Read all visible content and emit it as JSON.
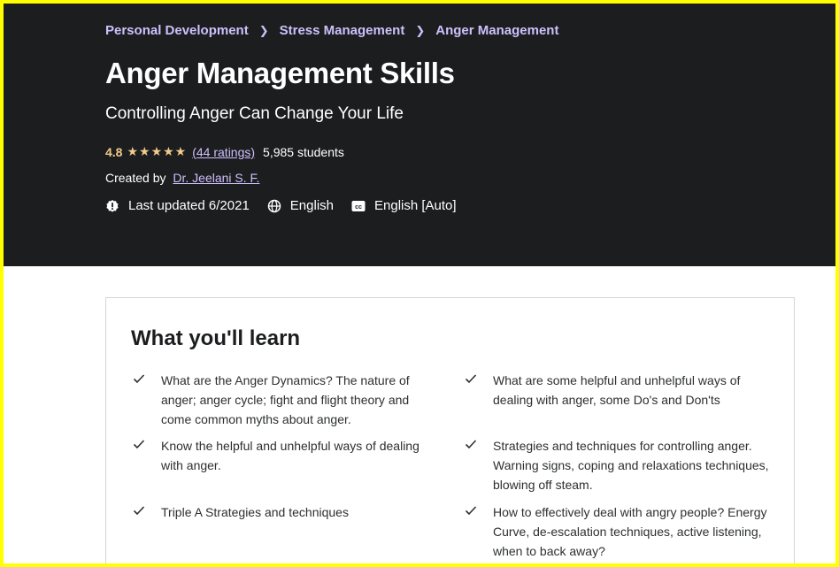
{
  "breadcrumb": [
    "Personal Development",
    "Stress Management",
    "Anger Management"
  ],
  "course": {
    "title": "Anger Management Skills",
    "subtitle": "Controlling Anger Can Change Your Life",
    "rating": "4.8",
    "stars": "★★★★★",
    "ratings_count": "(44 ratings)",
    "students": "5,985 students",
    "created_by_label": "Created by",
    "instructor": "Dr. Jeelani S. F.",
    "last_updated": "Last updated 6/2021",
    "language": "English",
    "captions": "English [Auto]"
  },
  "learn": {
    "heading": "What you'll learn",
    "left": [
      "What are the Anger Dynamics? The nature of anger; anger cycle; fight and flight theory and come common myths about anger.",
      "Know the helpful and unhelpful ways of dealing with anger.",
      "Triple A Strategies and techniques"
    ],
    "right": [
      "What are some helpful and unhelpful ways of dealing with anger, some Do's and Don'ts",
      "Strategies and techniques for controlling anger. Warning signs, coping and relaxations techniques, blowing off steam.",
      "How to effectively deal with angry people? Energy Curve, de-escalation techniques, active listening, when to back away?"
    ]
  },
  "colors": {
    "hero_bg": "#1c1d1f",
    "link_purple": "#cec0fc",
    "star_gold": "#f3ca8c",
    "frame": "#ffff00"
  },
  "icons": [
    "chevron-right-icon",
    "star-icon",
    "alert-badge-icon",
    "globe-icon",
    "closed-captions-icon",
    "check-icon"
  ]
}
